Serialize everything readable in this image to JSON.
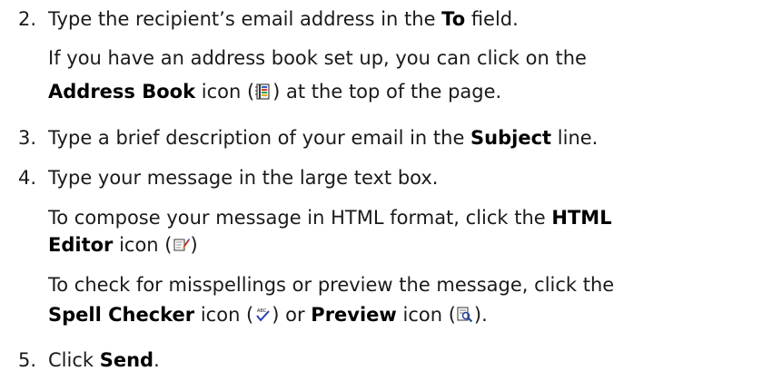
{
  "steps": [
    {
      "number": "2.",
      "main": {
        "pre": "Type the recipient’s email address in the ",
        "bold": "To",
        "post": " field."
      },
      "note": {
        "line1": "If you have an address book set up, you can click on the",
        "line2_bold": "Address Book",
        "line2_mid": " icon (",
        "line2_post": ") at the top of the page.",
        "icon": "address-book-icon"
      }
    },
    {
      "number": "3.",
      "main": {
        "pre": "Type a brief description of your email in the ",
        "bold": "Subject",
        "post": " line."
      }
    },
    {
      "number": "4.",
      "main": {
        "text": "Type your message in the large text box."
      },
      "note_html": {
        "line1_pre": "To compose your message in HTML format, click the ",
        "line1_bold": "HTML",
        "line2_bold": "Editor",
        "line2_post_pre": " icon (",
        "line2_post_end": ")",
        "icon": "html-editor-icon"
      },
      "note_spell": {
        "line1": "To check for misspellings or preview the message, click the",
        "line2_bold1": "Spell Checker",
        "line2_mid1": " icon (",
        "line2_mid2": ") or ",
        "line2_bold2": "Preview",
        "line2_mid3": " icon (",
        "line2_end": ").",
        "icon_spell": "spell-checker-icon",
        "icon_preview": "preview-icon"
      }
    },
    {
      "number": "5.",
      "main": {
        "pre": "Click ",
        "bold": "Send",
        "post": "."
      }
    }
  ]
}
